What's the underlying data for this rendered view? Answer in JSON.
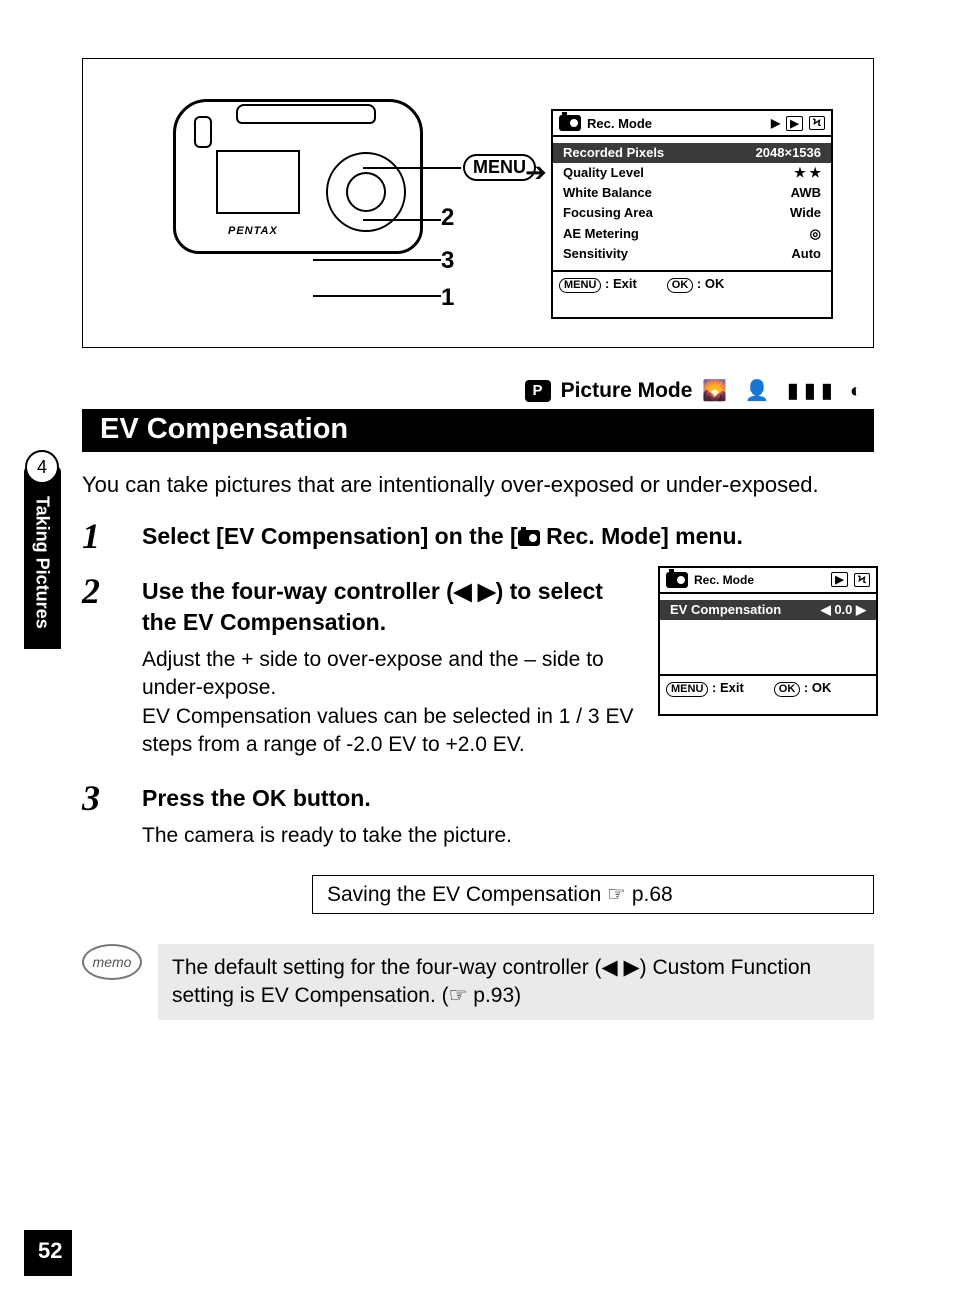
{
  "page_number": "52",
  "chapter": {
    "number": "4",
    "title": "Taking Pictures"
  },
  "picture_mode_label": "Picture Mode",
  "section_title": "EV Compensation",
  "intro": "You can take pictures that are intentionally over-exposed or under-exposed.",
  "illustration": {
    "menu_chip": "MENU",
    "callouts": {
      "1": "1",
      "2": "2",
      "3": "3"
    },
    "camera_brand": "PENTAX"
  },
  "lcd_main": {
    "title": "Rec. Mode",
    "rows": [
      {
        "label": "Recorded Pixels",
        "value": "2048×1536"
      },
      {
        "label": "Quality Level",
        "value": "★ ★"
      },
      {
        "label": "White Balance",
        "value": "AWB"
      },
      {
        "label": "Focusing Area",
        "value": "Wide"
      },
      {
        "label": "AE Metering",
        "value": "◎"
      },
      {
        "label": "Sensitivity",
        "value": "Auto"
      }
    ],
    "foot": {
      "menu_btn": "MENU",
      "exit": "Exit",
      "ok_btn": "OK",
      "ok": "OK"
    }
  },
  "steps": [
    {
      "head_pre": "Select [EV Compensation] on the [",
      "head_post": " Rec. Mode] menu."
    },
    {
      "head": "Use the four-way controller (◀ ▶) to select the EV Compensation.",
      "body": "Adjust the + side to over-expose and the – side to under-expose.\nEV Compensation values can be selected in 1 / 3 EV steps from a range of -2.0 EV to +2.0 EV."
    },
    {
      "head": "Press the OK button.",
      "body": "The camera is ready to take the picture."
    }
  ],
  "lcd_ev": {
    "title": "Rec. Mode",
    "row_label": "EV Compensation",
    "row_value": "0.0",
    "foot": {
      "menu_btn": "MENU",
      "exit": "Exit",
      "ok_btn": "OK",
      "ok": "OK"
    }
  },
  "refbox": "Saving the EV Compensation ☞ p.68",
  "memo_label": "memo",
  "memo_text": "The default setting for the four-way controller (◀ ▶) Custom Function setting is EV Compensation. (☞ p.93)"
}
